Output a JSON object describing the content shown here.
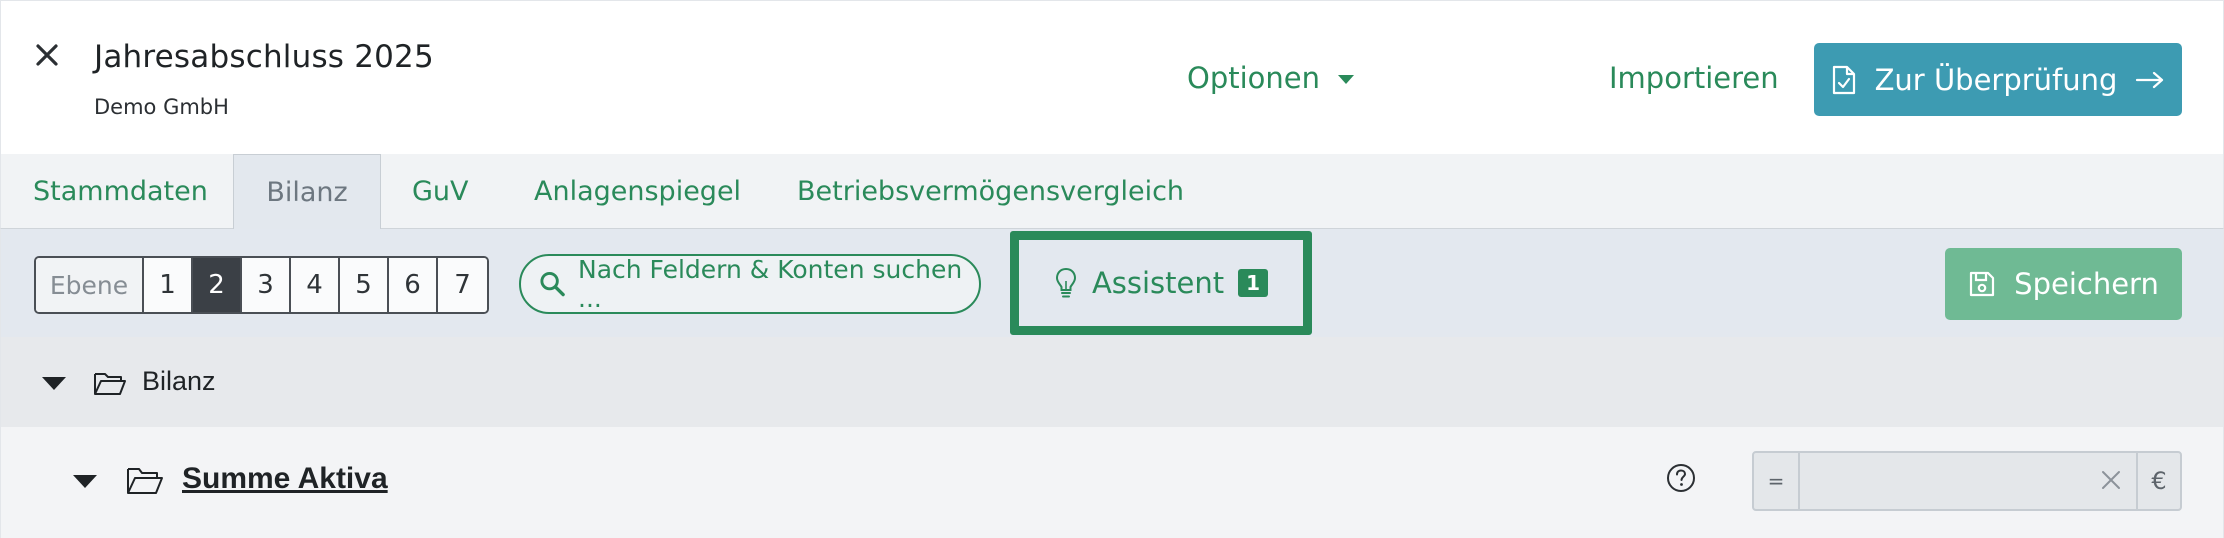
{
  "header": {
    "title": "Jahresabschluss 2025",
    "subtitle": "Demo GmbH",
    "options_label": "Optionen",
    "import_label": "Importieren",
    "review_label": "Zur Überprüfung"
  },
  "tabs": [
    {
      "label": "Stammdaten",
      "active": false
    },
    {
      "label": "Bilanz",
      "active": true
    },
    {
      "label": "GuV",
      "active": false
    },
    {
      "label": "Anlagenspiegel",
      "active": false
    },
    {
      "label": "Betriebsvermögensvergleich",
      "active": false
    }
  ],
  "toolbar": {
    "level_label": "Ebene",
    "levels": [
      "1",
      "2",
      "3",
      "4",
      "5",
      "6",
      "7"
    ],
    "active_level": "2",
    "search_label": "Nach Feldern & Konten suchen ...",
    "assistant_label": "Assistent",
    "assistant_count": "1",
    "save_label": "Speichern"
  },
  "tree": {
    "root_label": "Bilanz",
    "child_label": "Summe Aktiva",
    "field_prefix": "=",
    "field_value": "",
    "currency": "€"
  },
  "colors": {
    "accent_green": "#2a8a5a",
    "review_blue": "#3d9bb2",
    "save_green": "#6fba94"
  }
}
